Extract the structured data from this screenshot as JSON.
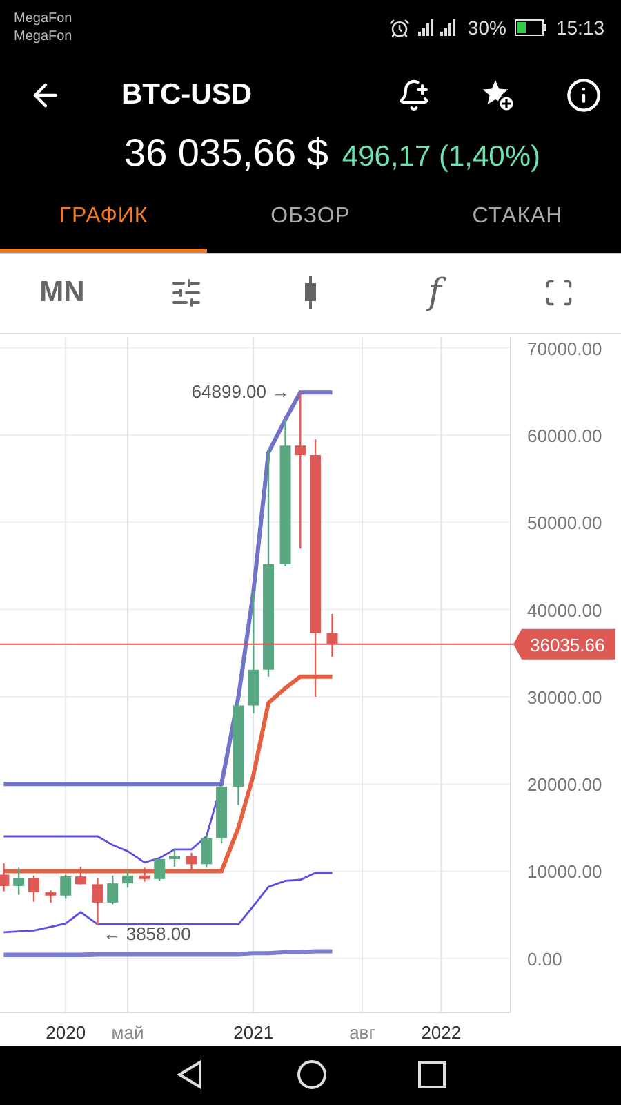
{
  "status_bar": {
    "carriers": [
      "MegaFon",
      "MegaFon"
    ],
    "battery_text": "30%",
    "time": "15:13"
  },
  "header": {
    "symbol": "BTC-USD",
    "price": "36 035,66 $",
    "change": "496,17 (1,40%)"
  },
  "tabs": [
    {
      "label": "ГРАФИК",
      "selected": true
    },
    {
      "label": "ОБЗОР",
      "selected": false
    },
    {
      "label": "СТАКАН",
      "selected": false
    }
  ],
  "toolbar": {
    "period": "MN",
    "function_label": "f"
  },
  "chart": {
    "chart_data": {
      "type": "candlestick",
      "x": [
        2019.67,
        2019.75,
        2019.83,
        2019.92,
        2020,
        2020.08,
        2020.17,
        2020.25,
        2020.33,
        2020.42,
        2020.5,
        2020.58,
        2020.67,
        2020.75,
        2020.83,
        2020.92,
        2021,
        2021.08,
        2021.17,
        2021.25,
        2021.33,
        2021.42
      ],
      "xlim": [
        2019.65,
        2022.37
      ],
      "ylim": [
        -6200,
        71250
      ],
      "xticks": [
        {
          "value": 2020,
          "label": "2020"
        },
        {
          "value": 2020.33,
          "label": "май"
        },
        {
          "value": 2021,
          "label": "2021"
        },
        {
          "value": 2021.58,
          "label": "авг"
        },
        {
          "value": 2022,
          "label": "2022"
        }
      ],
      "yticks": [
        {
          "value": 70000,
          "label": "70000.00"
        },
        {
          "value": 60000,
          "label": "60000.00"
        },
        {
          "value": 50000,
          "label": "50000.00"
        },
        {
          "value": 40000,
          "label": "40000.00"
        },
        {
          "value": 30000,
          "label": "30000.00"
        },
        {
          "value": 20000,
          "label": "20000.00"
        },
        {
          "value": 10000,
          "label": "10000.00"
        },
        {
          "value": 0,
          "label": "0.00"
        }
      ],
      "ohlc": [
        [
          9600,
          10900,
          7700,
          8300
        ],
        [
          8300,
          10400,
          7300,
          9200
        ],
        [
          9200,
          9500,
          6500,
          7600
        ],
        [
          7600,
          7800,
          6400,
          7200
        ],
        [
          7200,
          9600,
          6900,
          9400
        ],
        [
          9400,
          10500,
          8500,
          8500
        ],
        [
          8500,
          9200,
          3858,
          6400
        ],
        [
          6400,
          9500,
          6200,
          8600
        ],
        [
          8600,
          10100,
          8100,
          9500
        ],
        [
          9500,
          10400,
          8800,
          9100
        ],
        [
          9100,
          11400,
          8900,
          11400
        ],
        [
          11400,
          12500,
          10500,
          11700
        ],
        [
          11700,
          12100,
          9900,
          10800
        ],
        [
          10800,
          14100,
          10400,
          13800
        ],
        [
          13800,
          19900,
          13200,
          19700
        ],
        [
          19700,
          29300,
          17600,
          29000
        ],
        [
          29000,
          42000,
          28100,
          33100
        ],
        [
          33100,
          58400,
          32300,
          45200
        ],
        [
          45200,
          61800,
          45000,
          58800
        ],
        [
          58800,
          64899,
          47000,
          57700
        ],
        [
          57700,
          59500,
          30000,
          37300
        ],
        [
          37300,
          39500,
          34600,
          36035.66
        ]
      ],
      "grid": true,
      "series": [
        {
          "type": "line",
          "color": "#6f74c8",
          "values": [
            20000,
            20000,
            20000,
            20000,
            20000,
            20000,
            20000,
            20000,
            20000,
            20000,
            20000,
            20000,
            20000,
            20000,
            20000,
            30000,
            42000,
            58000,
            61800,
            64900,
            64900,
            64900
          ]
        },
        {
          "type": "line",
          "color": "#e4603f",
          "values": [
            10000,
            10000,
            10000,
            10000,
            10000,
            10000,
            10000,
            10000,
            10000,
            10000,
            10000,
            10000,
            10000,
            10000,
            10000,
            15000,
            21000,
            29300,
            31000,
            32300,
            32300,
            32300
          ]
        },
        {
          "type": "line",
          "color": "#5b4fe0",
          "values": [
            14000,
            14000,
            14000,
            14000,
            14000,
            14000,
            14000,
            13000,
            12300,
            11000,
            11500,
            12500,
            12500,
            14000,
            20000,
            null,
            null,
            null,
            null,
            null,
            null,
            null
          ]
        },
        {
          "type": "line",
          "color": "#5b4fe0",
          "values": [
            3000,
            3100,
            3200,
            3600,
            4000,
            5300,
            3900,
            3900,
            3900,
            3900,
            3900,
            3900,
            3900,
            3900,
            3900,
            3900,
            6000,
            8200,
            8900,
            9000,
            9800,
            9800
          ]
        },
        {
          "type": "line",
          "color": "#7b7fd0",
          "values": [
            400,
            400,
            400,
            400,
            400,
            400,
            500,
            500,
            500,
            500,
            500,
            500,
            500,
            500,
            500,
            500,
            600,
            600,
            700,
            700,
            800,
            800
          ]
        }
      ],
      "annotations": [
        {
          "x": 2021.25,
          "y": 64899,
          "text": "64899.00 →"
        },
        {
          "x": 2020.17,
          "y": 3858,
          "text": "← 3858.00"
        }
      ],
      "ref_lines": [
        {
          "axis": "y",
          "value": 36035.66,
          "label": "36035.66",
          "color": "#e05a55"
        }
      ]
    }
  }
}
